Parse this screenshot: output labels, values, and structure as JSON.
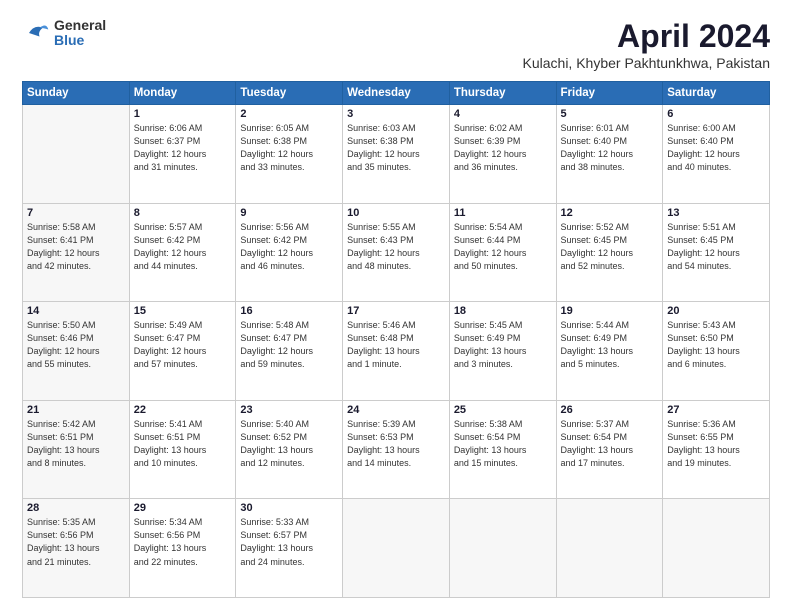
{
  "header": {
    "logo": {
      "general": "General",
      "blue": "Blue"
    },
    "title": "April 2024",
    "location": "Kulachi, Khyber Pakhtunkhwa, Pakistan"
  },
  "days_of_week": [
    "Sunday",
    "Monday",
    "Tuesday",
    "Wednesday",
    "Thursday",
    "Friday",
    "Saturday"
  ],
  "weeks": [
    [
      {
        "day": "",
        "info": ""
      },
      {
        "day": "1",
        "info": "Sunrise: 6:06 AM\nSunset: 6:37 PM\nDaylight: 12 hours\nand 31 minutes."
      },
      {
        "day": "2",
        "info": "Sunrise: 6:05 AM\nSunset: 6:38 PM\nDaylight: 12 hours\nand 33 minutes."
      },
      {
        "day": "3",
        "info": "Sunrise: 6:03 AM\nSunset: 6:38 PM\nDaylight: 12 hours\nand 35 minutes."
      },
      {
        "day": "4",
        "info": "Sunrise: 6:02 AM\nSunset: 6:39 PM\nDaylight: 12 hours\nand 36 minutes."
      },
      {
        "day": "5",
        "info": "Sunrise: 6:01 AM\nSunset: 6:40 PM\nDaylight: 12 hours\nand 38 minutes."
      },
      {
        "day": "6",
        "info": "Sunrise: 6:00 AM\nSunset: 6:40 PM\nDaylight: 12 hours\nand 40 minutes."
      }
    ],
    [
      {
        "day": "7",
        "info": "Sunrise: 5:58 AM\nSunset: 6:41 PM\nDaylight: 12 hours\nand 42 minutes."
      },
      {
        "day": "8",
        "info": "Sunrise: 5:57 AM\nSunset: 6:42 PM\nDaylight: 12 hours\nand 44 minutes."
      },
      {
        "day": "9",
        "info": "Sunrise: 5:56 AM\nSunset: 6:42 PM\nDaylight: 12 hours\nand 46 minutes."
      },
      {
        "day": "10",
        "info": "Sunrise: 5:55 AM\nSunset: 6:43 PM\nDaylight: 12 hours\nand 48 minutes."
      },
      {
        "day": "11",
        "info": "Sunrise: 5:54 AM\nSunset: 6:44 PM\nDaylight: 12 hours\nand 50 minutes."
      },
      {
        "day": "12",
        "info": "Sunrise: 5:52 AM\nSunset: 6:45 PM\nDaylight: 12 hours\nand 52 minutes."
      },
      {
        "day": "13",
        "info": "Sunrise: 5:51 AM\nSunset: 6:45 PM\nDaylight: 12 hours\nand 54 minutes."
      }
    ],
    [
      {
        "day": "14",
        "info": "Sunrise: 5:50 AM\nSunset: 6:46 PM\nDaylight: 12 hours\nand 55 minutes."
      },
      {
        "day": "15",
        "info": "Sunrise: 5:49 AM\nSunset: 6:47 PM\nDaylight: 12 hours\nand 57 minutes."
      },
      {
        "day": "16",
        "info": "Sunrise: 5:48 AM\nSunset: 6:47 PM\nDaylight: 12 hours\nand 59 minutes."
      },
      {
        "day": "17",
        "info": "Sunrise: 5:46 AM\nSunset: 6:48 PM\nDaylight: 13 hours\nand 1 minute."
      },
      {
        "day": "18",
        "info": "Sunrise: 5:45 AM\nSunset: 6:49 PM\nDaylight: 13 hours\nand 3 minutes."
      },
      {
        "day": "19",
        "info": "Sunrise: 5:44 AM\nSunset: 6:49 PM\nDaylight: 13 hours\nand 5 minutes."
      },
      {
        "day": "20",
        "info": "Sunrise: 5:43 AM\nSunset: 6:50 PM\nDaylight: 13 hours\nand 6 minutes."
      }
    ],
    [
      {
        "day": "21",
        "info": "Sunrise: 5:42 AM\nSunset: 6:51 PM\nDaylight: 13 hours\nand 8 minutes."
      },
      {
        "day": "22",
        "info": "Sunrise: 5:41 AM\nSunset: 6:51 PM\nDaylight: 13 hours\nand 10 minutes."
      },
      {
        "day": "23",
        "info": "Sunrise: 5:40 AM\nSunset: 6:52 PM\nDaylight: 13 hours\nand 12 minutes."
      },
      {
        "day": "24",
        "info": "Sunrise: 5:39 AM\nSunset: 6:53 PM\nDaylight: 13 hours\nand 14 minutes."
      },
      {
        "day": "25",
        "info": "Sunrise: 5:38 AM\nSunset: 6:54 PM\nDaylight: 13 hours\nand 15 minutes."
      },
      {
        "day": "26",
        "info": "Sunrise: 5:37 AM\nSunset: 6:54 PM\nDaylight: 13 hours\nand 17 minutes."
      },
      {
        "day": "27",
        "info": "Sunrise: 5:36 AM\nSunset: 6:55 PM\nDaylight: 13 hours\nand 19 minutes."
      }
    ],
    [
      {
        "day": "28",
        "info": "Sunrise: 5:35 AM\nSunset: 6:56 PM\nDaylight: 13 hours\nand 21 minutes."
      },
      {
        "day": "29",
        "info": "Sunrise: 5:34 AM\nSunset: 6:56 PM\nDaylight: 13 hours\nand 22 minutes."
      },
      {
        "day": "30",
        "info": "Sunrise: 5:33 AM\nSunset: 6:57 PM\nDaylight: 13 hours\nand 24 minutes."
      },
      {
        "day": "",
        "info": ""
      },
      {
        "day": "",
        "info": ""
      },
      {
        "day": "",
        "info": ""
      },
      {
        "day": "",
        "info": ""
      }
    ]
  ]
}
